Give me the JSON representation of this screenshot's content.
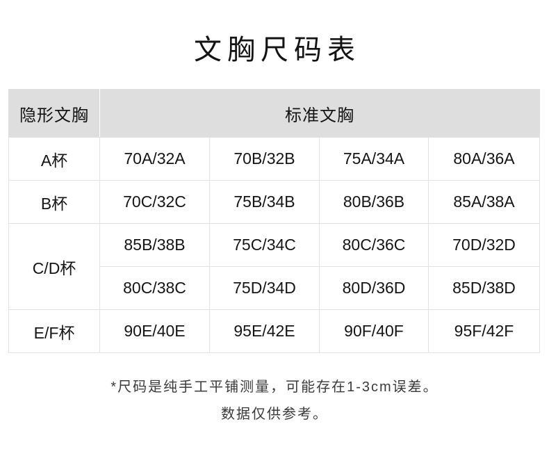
{
  "page": {
    "title": "文胸尺码表"
  },
  "table": {
    "headers": [
      {
        "label": "隐形文胸",
        "colspan": 1
      },
      {
        "label": "标准文胸",
        "colspan": 4
      }
    ],
    "rows": [
      {
        "cup": "A杯",
        "cup_rowspan": 1,
        "sizes": [
          "70A/32A",
          "70B/32B",
          "75A/34A",
          "80A/36A"
        ]
      },
      {
        "cup": "B杯",
        "cup_rowspan": 1,
        "sizes": [
          "70C/32C",
          "75B/34B",
          "80B/36B",
          "85A/38A"
        ]
      },
      {
        "cup": "C/D杯",
        "cup_rowspan": 2,
        "sizes": [
          "85B/38B",
          "75C/34C",
          "80C/36C",
          "70D/32D"
        ]
      },
      {
        "cup": "",
        "cup_rowspan": 0,
        "sizes": [
          "80C/38C",
          "75D/34D",
          "80D/36D",
          "85D/38D"
        ]
      },
      {
        "cup": "E/F杯",
        "cup_rowspan": 1,
        "sizes": [
          "90E/40E",
          "95E/42E",
          "90F/40F",
          "95F/42F"
        ]
      }
    ]
  },
  "footnotes": [
    "*尺码是纯手工平铺测量，可能存在1-3cm误差。",
    "数据仅供参考。"
  ],
  "colors": {
    "header_background": "#dedede",
    "border": "#e2e2e2",
    "text": "#141414",
    "footnote_text": "#3a3a3a",
    "background": "#ffffff"
  }
}
